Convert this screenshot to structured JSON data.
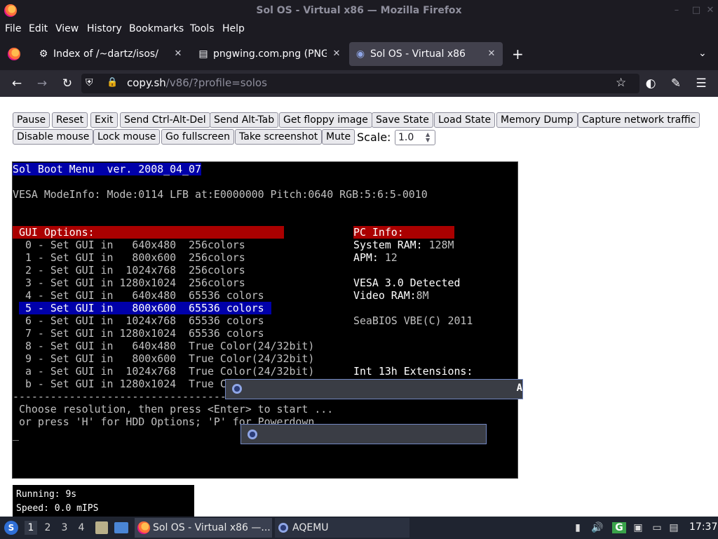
{
  "window": {
    "title": "Sol OS - Virtual x86 — Mozilla Firefox"
  },
  "menubar": [
    "File",
    "Edit",
    "View",
    "History",
    "Bookmarks",
    "Tools",
    "Help"
  ],
  "tabs": [
    {
      "label": "Index of /~dartz/isos/",
      "icon": "puzzle-icon",
      "active": false
    },
    {
      "label": "pngwing.com.png (PNG I",
      "icon": "image-file-icon",
      "active": false
    },
    {
      "label": "Sol OS - Virtual x86",
      "icon": "sol-os-icon",
      "active": true
    }
  ],
  "tab_new_label": "+",
  "url": {
    "host": "copy.sh",
    "path": "/v86/?profile=solos"
  },
  "toolbar_buttons_row1": [
    "Pause",
    "Reset",
    "Exit",
    "Send Ctrl-Alt-Del",
    "Send Alt-Tab",
    "Get floppy image",
    "Save State",
    "Load State",
    "Memory Dump",
    "Capture network traffic"
  ],
  "toolbar_buttons_row2": [
    "Disable mouse",
    "Lock mouse",
    "Go fullscreen",
    "Take screenshot",
    "Mute"
  ],
  "scale": {
    "label": "Scale:",
    "value": "1.0"
  },
  "vm_screen": {
    "header": "Sol Boot Menu  ver. 2008_04_07",
    "vesa_info": "VESA ModeInfo: Mode:0114 LFB at:E0000000 Pitch:0640 RGB:5:6:5-0010",
    "gui_options_title": " GUI Options:",
    "gui_options": [
      " 0 - Set GUI in   640x480  256colors",
      " 1 - Set GUI in   800x600  256colors",
      " 2 - Set GUI in  1024x768  256colors",
      " 3 - Set GUI in 1280x1024  256colors",
      " 4 - Set GUI in   640x480  65536 colors",
      " 5 - Set GUI in   800x600  65536 colors",
      " 6 - Set GUI in  1024x768  65536 colors",
      " 7 - Set GUI in 1280x1024  65536 colors",
      " 8 - Set GUI in   640x480  True Color(24/32bit)",
      " 9 - Set GUI in   800x600  True Color(24/32bit)",
      " a - Set GUI in  1024x768  True Color(24/32bit)",
      " b - Set GUI in 1280x1024  True C"
    ],
    "selected_index": 5,
    "pc_info_title": "PC Info:",
    "system_ram_label": "System RAM:",
    "system_ram_value": " 128M",
    "apm_label": "APM:",
    "apm_value": " 12",
    "vesa_detected": "VESA 3.0 Detected",
    "video_ram_label": "Video RAM:",
    "video_ram_value": "8M",
    "seabios": "SeaBIOS VBE(C) 2011",
    "int13": "Int 13h Extensions:",
    "separator": "-----------------------------------",
    "prompt_line1": " Choose resolution, then press <Enter> to start ...",
    "prompt_line2": " or press 'H' for HDD Options; 'P' for Powerdown",
    "cursor": "_",
    "overlay_text": "A"
  },
  "status": {
    "running": "Running: 9s",
    "speed": "Speed: 0.0 mIPS"
  },
  "taskbar": {
    "workspaces": [
      "1",
      "2",
      "3",
      "4"
    ],
    "tasks": [
      {
        "label": "Sol OS - Virtual x86 —...",
        "icon": "firefox-icon"
      },
      {
        "label": "AQEMU",
        "icon": "aqemu-icon"
      }
    ],
    "clock": "17:37"
  },
  "colors": {
    "chrome": "#1c1b22",
    "navbar": "#2b2a33",
    "highlight_blue": "#0000aa",
    "highlight_red": "#aa0000",
    "taskbar": "#1f2430"
  }
}
